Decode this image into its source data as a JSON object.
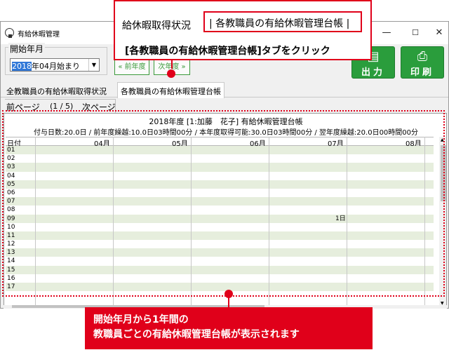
{
  "window": {
    "title": "有給休暇管理",
    "controls": {
      "minimize": "—",
      "maximize": "☐",
      "close": "✕"
    }
  },
  "period": {
    "legend": "開始年月",
    "selected_year": "2018",
    "selected_rest": "年04月始まり"
  },
  "nav": {
    "prev_label": "« 前年度",
    "next_label": "次年度 »"
  },
  "toolbar": {
    "output_label": "出力",
    "print_label": "印刷"
  },
  "tabs": [
    {
      "label": "全教職員の有給休暇取得状況"
    },
    {
      "label": "各教職員の有給休暇管理台帳"
    }
  ],
  "pager": {
    "prev": "前ページ",
    "page": "(1 / 5)",
    "next": "次ページ"
  },
  "ledger": {
    "heading": "2018年度 [1:加藤　花子] 有給休暇管理台帳",
    "summary": "付与日数:20.0日 / 前年度繰越:10.0日03時間00分 / 本年度取得可能:30.0日03時間00分 / 翌年度繰越:20.0日00時間00分",
    "columns": [
      "日付",
      "04月",
      "05月",
      "06月",
      "07月",
      "08月"
    ],
    "rows": [
      {
        "day": "01",
        "cells": [
          "",
          "",
          "",
          "",
          ""
        ]
      },
      {
        "day": "02",
        "cells": [
          "",
          "",
          "",
          "",
          ""
        ]
      },
      {
        "day": "03",
        "cells": [
          "",
          "",
          "",
          "",
          ""
        ]
      },
      {
        "day": "04",
        "cells": [
          "",
          "",
          "",
          "",
          ""
        ]
      },
      {
        "day": "05",
        "cells": [
          "",
          "",
          "",
          "",
          ""
        ]
      },
      {
        "day": "06",
        "cells": [
          "",
          "",
          "",
          "",
          ""
        ]
      },
      {
        "day": "07",
        "cells": [
          "",
          "",
          "",
          "",
          ""
        ]
      },
      {
        "day": "08",
        "cells": [
          "",
          "",
          "",
          "",
          ""
        ]
      },
      {
        "day": "09",
        "cells": [
          "",
          "",
          "",
          "1日",
          ""
        ]
      },
      {
        "day": "10",
        "cells": [
          "",
          "",
          "",
          "",
          ""
        ]
      },
      {
        "day": "11",
        "cells": [
          "",
          "",
          "",
          "",
          ""
        ]
      },
      {
        "day": "12",
        "cells": [
          "",
          "",
          "",
          "",
          ""
        ]
      },
      {
        "day": "13",
        "cells": [
          "",
          "",
          "",
          "",
          ""
        ]
      },
      {
        "day": "14",
        "cells": [
          "",
          "",
          "",
          "",
          ""
        ]
      },
      {
        "day": "15",
        "cells": [
          "",
          "",
          "",
          "",
          ""
        ]
      },
      {
        "day": "16",
        "cells": [
          "",
          "",
          "",
          "",
          ""
        ]
      },
      {
        "day": "17",
        "cells": [
          "",
          "",
          "",
          "",
          ""
        ]
      }
    ]
  },
  "annotations": {
    "top_tab_left": "給休暇取得状況",
    "top_tab_sep": "|",
    "top_tab_right": "各教職員の有給休暇管理台帳",
    "top_tab_right_bar": "|",
    "top_message": "[各教職員の有給休暇管理台帳]タブをクリック",
    "bottom_line1": "開始年月から1年間の",
    "bottom_line2": "教職員ごとの有給休暇管理台帳が表示されます",
    "accent_color": "#e0001a"
  },
  "icons": {
    "output": "export-icon",
    "print": "printer-icon"
  }
}
